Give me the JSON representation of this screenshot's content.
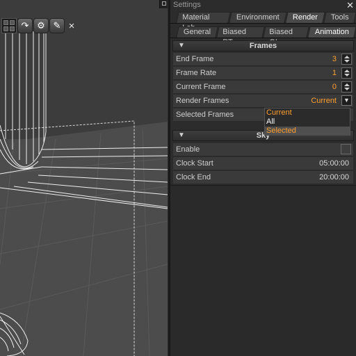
{
  "viewport": {
    "toolbar": {
      "layout_icon": "grid-layout-icon",
      "rotate_icon": "rotate-icon",
      "settings_icon": "gear-icon",
      "tools_icon": "tools-icon",
      "close_label": "×"
    }
  },
  "panel": {
    "title": "Settings",
    "close_label": "✕",
    "tabs_top": [
      {
        "label": "Material Lab",
        "active": false
      },
      {
        "label": "Environment",
        "active": false
      },
      {
        "label": "Render",
        "active": true
      },
      {
        "label": "Tools",
        "active": false
      }
    ],
    "tabs_sub": [
      {
        "label": "General",
        "active": false
      },
      {
        "label": "Biased RT",
        "active": false
      },
      {
        "label": "Biased GI",
        "active": false
      },
      {
        "label": "Animation",
        "active": true
      }
    ],
    "frames": {
      "header": "Frames",
      "end_frame": {
        "label": "End Frame",
        "value": "3"
      },
      "frame_rate": {
        "label": "Frame Rate",
        "value": "1"
      },
      "current_frame": {
        "label": "Current Frame",
        "value": "0"
      },
      "render_frames": {
        "label": "Render Frames",
        "value": "Current"
      },
      "selected_frames": {
        "label": "Selected Frames",
        "value": ""
      }
    },
    "dropdown": {
      "options": [
        "Current",
        "All",
        "Selected"
      ],
      "highlighted": "Selected"
    },
    "sky": {
      "header": "Sky",
      "enable": {
        "label": "Enable",
        "checked": false
      },
      "clock_start": {
        "label": "Clock Start",
        "value": "05:00:00"
      },
      "clock_end": {
        "label": "Clock End",
        "value": "20:00:00"
      }
    }
  },
  "colors": {
    "accent_orange": "#ffa030",
    "panel_bg": "#2c2c2c",
    "viewport_bg": "#4a4a4a"
  }
}
